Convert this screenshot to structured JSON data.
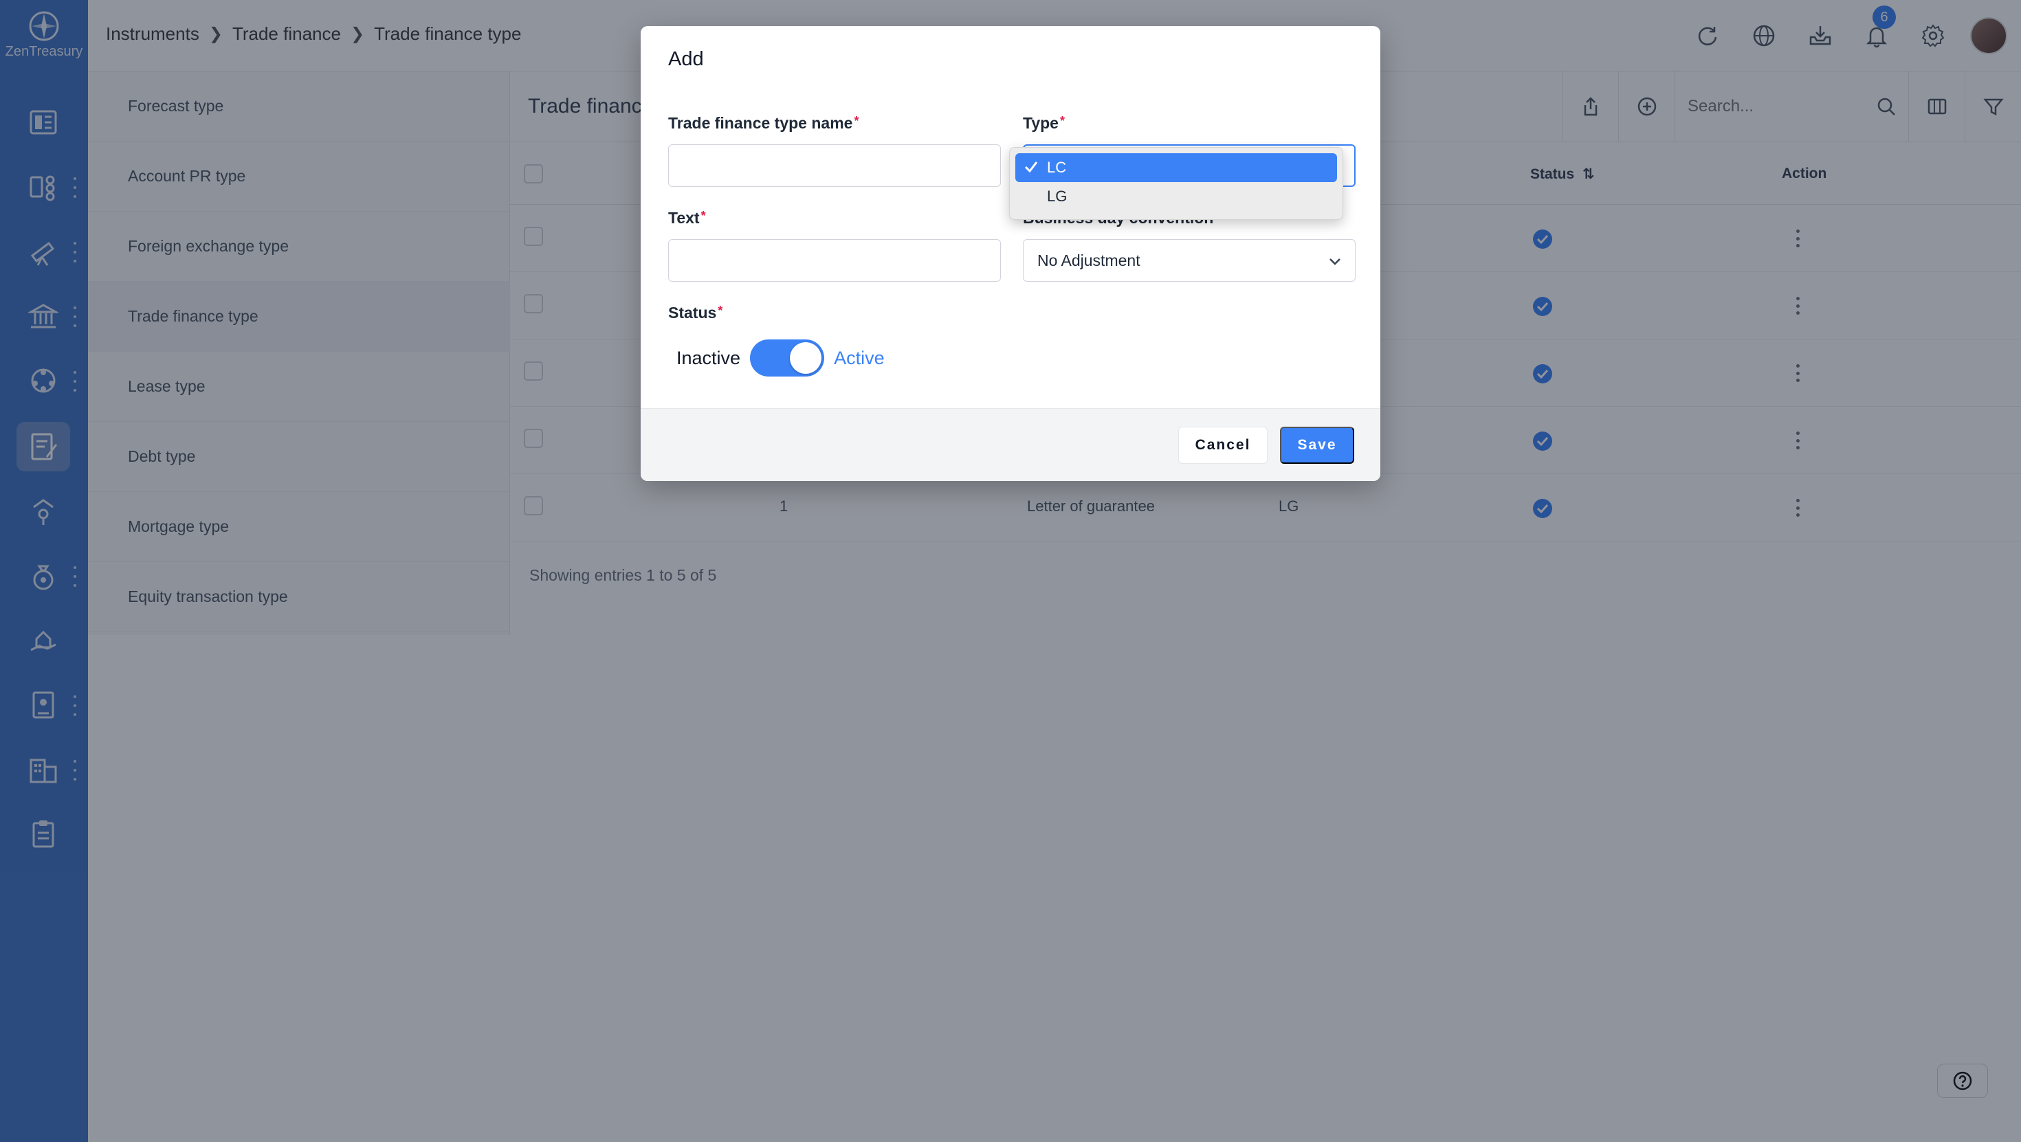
{
  "app": {
    "logo_text": "ZenTreasury"
  },
  "breadcrumb": [
    "Instruments",
    "Trade finance",
    "Trade finance type"
  ],
  "header": {
    "notification_count": "6"
  },
  "subnav": {
    "items": [
      "Forecast type",
      "Account PR type",
      "Foreign exchange type",
      "Trade finance type",
      "Lease type",
      "Debt type",
      "Mortgage type",
      "Equity transaction type"
    ]
  },
  "main": {
    "title": "Trade financ",
    "search_placeholder": "Search...",
    "columns": {
      "status": "Status",
      "action": "Action"
    },
    "last_row": {
      "id": "1",
      "name": "Letter of guarantee",
      "type": "LG"
    },
    "footer": "Showing entries 1 to 5 of 5"
  },
  "modal": {
    "title": "Add",
    "fields": {
      "name_label": "Trade finance type name",
      "type_label": "Type",
      "text_label": "Text",
      "bdc_label": "Business day convention",
      "bdc_value": "No Adjustment",
      "status_label": "Status",
      "required_mark": "*"
    },
    "toggle": {
      "off_label": "Inactive",
      "on_label": "Active"
    },
    "buttons": {
      "cancel": "Cancel",
      "save": "Save"
    }
  },
  "dropdown": {
    "options": [
      "LC",
      "LG"
    ],
    "selected": "LC"
  },
  "colors": {
    "accent": "#3b82f6",
    "sidebar": "#3f73c4",
    "required": "#e11d48"
  }
}
